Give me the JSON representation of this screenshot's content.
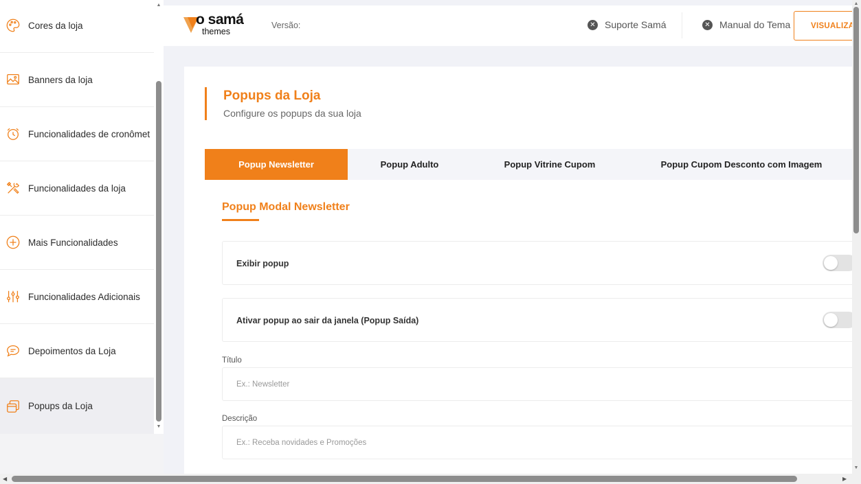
{
  "sidebar": {
    "items": [
      {
        "label": "Cores da loja",
        "icon": "palette-icon"
      },
      {
        "label": "Banners da loja",
        "icon": "image-icon"
      },
      {
        "label": "Funcionalidades de cronômet",
        "icon": "alarm-clock-icon"
      },
      {
        "label": "Funcionalidades da loja",
        "icon": "tools-icon"
      },
      {
        "label": "Mais Funcionalidades",
        "icon": "plus-circle-icon"
      },
      {
        "label": "Funcionalidades Adicionais",
        "icon": "sliders-icon"
      },
      {
        "label": "Depoimentos da Loja",
        "icon": "chat-bubble-icon"
      },
      {
        "label": "Popups da Loja",
        "icon": "windows-icon"
      }
    ],
    "active_index": 7
  },
  "header": {
    "logo_brand": "o samá",
    "logo_sub": "themes",
    "version_label": "Versão:",
    "support_link": "Suporte Samá",
    "manual_link": "Manual do Tema",
    "visualize_button": "VISUALIZAR"
  },
  "main": {
    "title": "Popups da Loja",
    "subtitle": "Configure os popups da sua loja",
    "tabs": [
      {
        "label": "Popup Newsletter",
        "active": true
      },
      {
        "label": "Popup Adulto",
        "active": false
      },
      {
        "label": "Popup Vitrine Cupom",
        "active": false
      },
      {
        "label": "Popup Cupom Desconto com Imagem",
        "active": false
      }
    ],
    "section_title": "Popup Modal Newsletter",
    "options": [
      {
        "label": "Exibir popup",
        "enabled": false
      },
      {
        "label": "Ativar popup ao sair da janela (Popup Saída)",
        "enabled": false
      }
    ],
    "fields": [
      {
        "label": "Título",
        "placeholder": "Ex.: Newsletter",
        "value": ""
      },
      {
        "label": "Descrição",
        "placeholder": "Ex.: Receba novidades e Promoções",
        "value": ""
      }
    ]
  },
  "colors": {
    "accent": "#f0801a",
    "sidebar_active": "#eeeef2",
    "background": "#f1f2f7"
  }
}
